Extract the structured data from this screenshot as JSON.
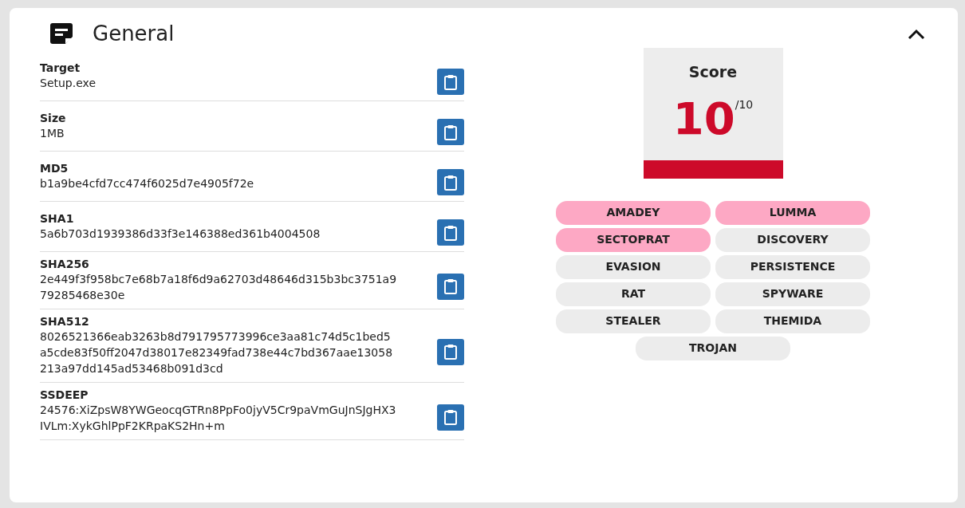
{
  "panel": {
    "title": "General",
    "expanded": true
  },
  "fields": [
    {
      "label": "Target",
      "value": "Setup.exe"
    },
    {
      "label": "Size",
      "value": "1MB"
    },
    {
      "label": "MD5",
      "value": "b1a9be4cfd7cc474f6025d7e4905f72e"
    },
    {
      "label": "SHA1",
      "value": "5a6b703d1939386d33f3e146388ed361b4004508"
    },
    {
      "label": "SHA256",
      "value": "2e449f3f958bc7e68b7a18f6d9a62703d48646d315b3bc3751a979285468e30e"
    },
    {
      "label": "SHA512",
      "value": "8026521366eab3263b8d791795773996ce3aa81c74d5c1bed5a5cde83f50ff2047d38017e82349fad738e44c7bd367aae13058213a97dd145ad53468b091d3cd"
    },
    {
      "label": "SSDEEP",
      "value": "24576:XiZpsW8YWGeocqGTRn8PpFo0jyV5Cr9paVmGuJnSJgHX3IVLm:XykGhlPpF2KRpaKS2Hn+m"
    }
  ],
  "score": {
    "title": "Score",
    "value": "10",
    "max": "/10",
    "level": 1
  },
  "tags": [
    {
      "label": "AMADEY",
      "color": "#fda8c4"
    },
    {
      "label": "LUMMA",
      "color": "#fda8c4"
    },
    {
      "label": "SECTOPRAT",
      "color": "#fda8c4"
    },
    {
      "label": "DISCOVERY",
      "color": "#ececec"
    },
    {
      "label": "EVASION",
      "color": "#ececec"
    },
    {
      "label": "PERSISTENCE",
      "color": "#ececec"
    },
    {
      "label": "RAT",
      "color": "#ececec"
    },
    {
      "label": "SPYWARE",
      "color": "#ececec"
    },
    {
      "label": "STEALER",
      "color": "#ececec"
    },
    {
      "label": "THEMIDA",
      "color": "#ececec"
    },
    {
      "label": "TROJAN",
      "color": "#ececec"
    }
  ]
}
